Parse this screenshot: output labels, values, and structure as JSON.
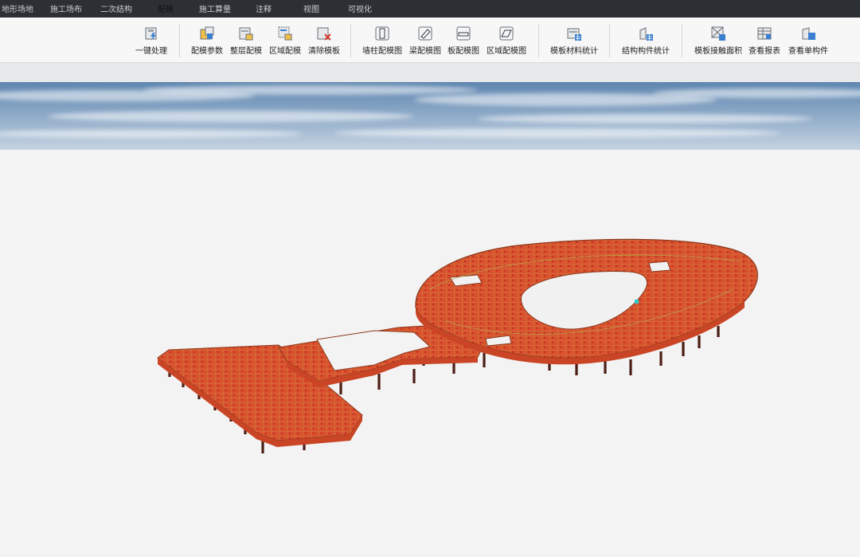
{
  "tabs": [
    {
      "label": "地形场地",
      "active": false
    },
    {
      "label": "施工场布",
      "active": false
    },
    {
      "label": "二次结构",
      "active": false
    },
    {
      "label": "配模",
      "active": true
    },
    {
      "label": "施工算量",
      "active": false
    },
    {
      "label": "注释",
      "active": false
    },
    {
      "label": "视图",
      "active": false
    },
    {
      "label": "可视化",
      "active": false
    }
  ],
  "ribbon": {
    "one_click": "一键处理",
    "mold_params": "配模参数",
    "floor_mold": "整层配模",
    "area_mold": "区域配模",
    "clear_formwork": "清除模板",
    "wall_column_drawing": "墙柱配模图",
    "beam_drawing": "梁配模图",
    "slab_drawing": "板配模图",
    "area_drawing": "区域配模图",
    "formwork_stats": "模板材料统计",
    "component_stats": "结构构件统计",
    "contact_area": "模板接触面积",
    "view_report": "查看报表",
    "view_component": "查看单构件"
  },
  "colors": {
    "accent_icon": "#3b7fd1",
    "formwork": "#d9502e",
    "formwork_line": "#b8a34a",
    "column": "#4a1d14"
  }
}
